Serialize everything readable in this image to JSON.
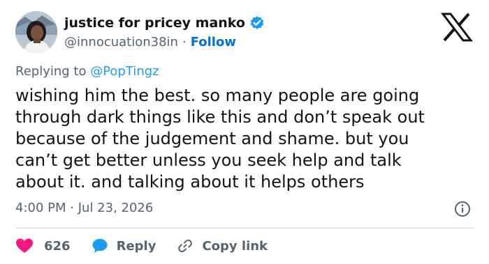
{
  "author": {
    "display_name": "justice for pricey manko",
    "handle": "@innocuation38in",
    "separator": "·",
    "follow_label": "Follow",
    "verified": true
  },
  "reply_context": {
    "prefix": "Replying to",
    "mention": "@PopTingz"
  },
  "tweet": {
    "text": "wishing him the best. so many people are going\nthrough dark things like this and don’t speak out\nbecause of the judgement and shame. but you\ncan’t get better unless you seek help and talk\nabout it. and talking about it helps others",
    "time": "4:00 PM",
    "separator": "·",
    "date": "Jul 23, 2026"
  },
  "actions": {
    "like_count": "626",
    "reply_label": "Reply",
    "copy_label": "Copy link"
  },
  "icons": {
    "brand": "x-logo-icon",
    "verified": "verified-badge-icon",
    "info": "info-icon",
    "like": "heart-icon",
    "reply": "speech-bubble-icon",
    "copy": "link-icon"
  },
  "colors": {
    "text": "#0f1419",
    "muted": "#536471",
    "link": "#1d9bf0",
    "follow": "#006fd6",
    "like": "#f91880",
    "divider": "#cfd9de"
  }
}
